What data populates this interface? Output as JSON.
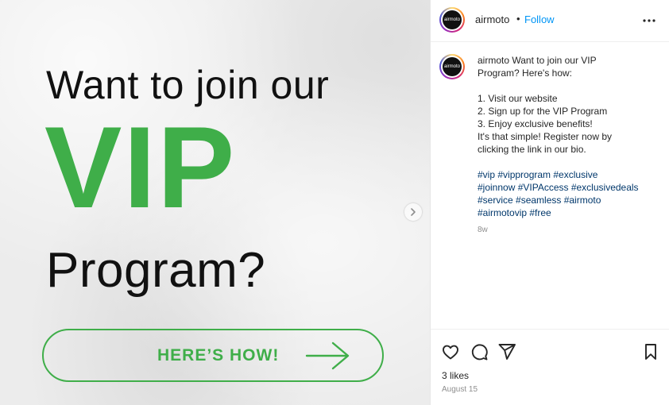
{
  "post_image": {
    "headline_line1": "Want to join our",
    "headline_vip": "VIP",
    "headline_line2": "Program?",
    "cta_label": "HERE’S HOW!",
    "accent_color": "#3fae49"
  },
  "header": {
    "username": "airmoto",
    "separator": "•",
    "follow_label": "Follow",
    "avatar_text": "airmoto"
  },
  "caption": {
    "username": "airmoto",
    "lines": [
      "Want to join our VIP",
      "Program? Here's how:",
      "1. Visit our website",
      "2. Sign up for the VIP Program",
      "3. Enjoy exclusive benefits!",
      "It's that simple! Register now by",
      "clicking the link in our bio."
    ],
    "hashtag_lines": [
      "#vip #vipprogram #exclusive",
      "#joinnow #VIPAccess #exclusivedeals",
      "#service #seamless #airmoto",
      "#airmotovip #free"
    ],
    "time_ago": "8w"
  },
  "actions": {
    "icons": [
      "heart-icon",
      "comment-icon",
      "share-icon",
      "bookmark-icon"
    ]
  },
  "stats": {
    "likes": "3 likes",
    "date": "August 15"
  }
}
